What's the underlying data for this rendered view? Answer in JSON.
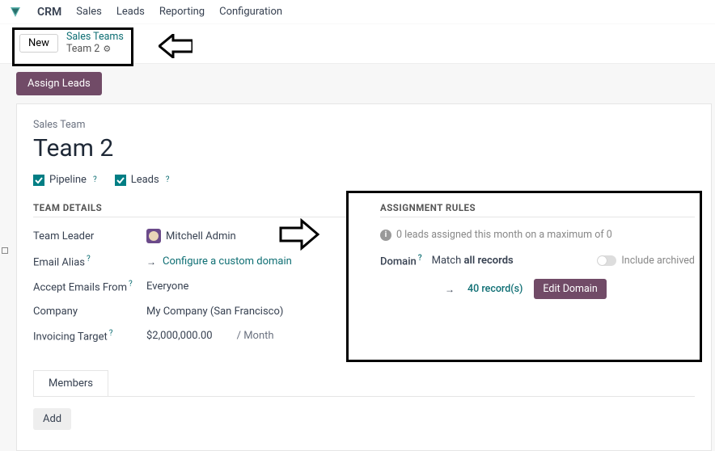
{
  "nav": {
    "app": "CRM",
    "items": [
      "Sales",
      "Leads",
      "Reporting",
      "Configuration"
    ]
  },
  "breadcrumb": {
    "new_btn": "New",
    "parent": "Sales Teams",
    "current": "Team 2"
  },
  "actions": {
    "assign_leads": "Assign Leads"
  },
  "form": {
    "label": "Sales Team",
    "title": "Team 2",
    "checks": {
      "pipeline": "Pipeline",
      "leads": "Leads"
    }
  },
  "team_details": {
    "header": "TEAM DETAILS",
    "leader_label": "Team Leader",
    "leader_value": "Mitchell Admin",
    "alias_label": "Email Alias",
    "alias_link": "Configure a custom domain",
    "accept_label": "Accept Emails From",
    "accept_value": "Everyone",
    "company_label": "Company",
    "company_value": "My Company (San Francisco)",
    "target_label": "Invoicing Target",
    "target_value": "$2,000,000.00",
    "target_unit": "/ Month"
  },
  "assignment": {
    "header": "ASSIGNMENT RULES",
    "info": "0 leads assigned this month on a maximum of 0",
    "domain_label": "Domain",
    "match_prefix": "Match ",
    "match_bold": "all records",
    "include_archived": "Include archived",
    "records_link": "40 record(s)",
    "edit_domain": "Edit Domain"
  },
  "tabs": {
    "members": "Members",
    "add": "Add"
  }
}
